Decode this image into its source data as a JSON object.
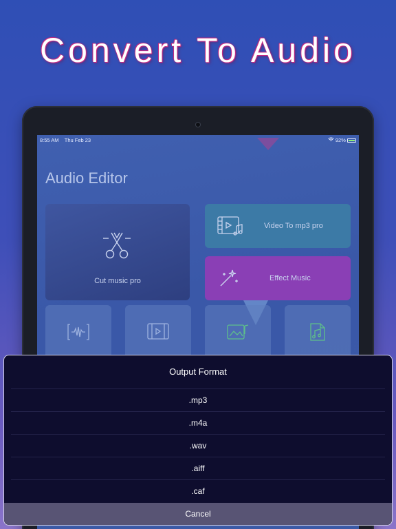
{
  "headline": "Convert To Audio",
  "status_bar": {
    "time": "8:55 AM",
    "date": "Thu Feb 23",
    "battery": "92%"
  },
  "app": {
    "title": "Audio Editor",
    "cards": {
      "cut_music": "Cut music pro",
      "video_to_mp3": "Video To mp3 pro",
      "effect_music": "Effect Music"
    }
  },
  "sheet": {
    "title": "Output Format",
    "options": [
      ".mp3",
      ".m4a",
      ".wav",
      ".aiff",
      ".caf"
    ],
    "cancel_label": "Cancel"
  },
  "colors": {
    "sheet_background": "#0e0d2e",
    "cancel_background": "#585474",
    "effect_card": "#8a3fb5",
    "video_card": "#3c7aa6"
  }
}
